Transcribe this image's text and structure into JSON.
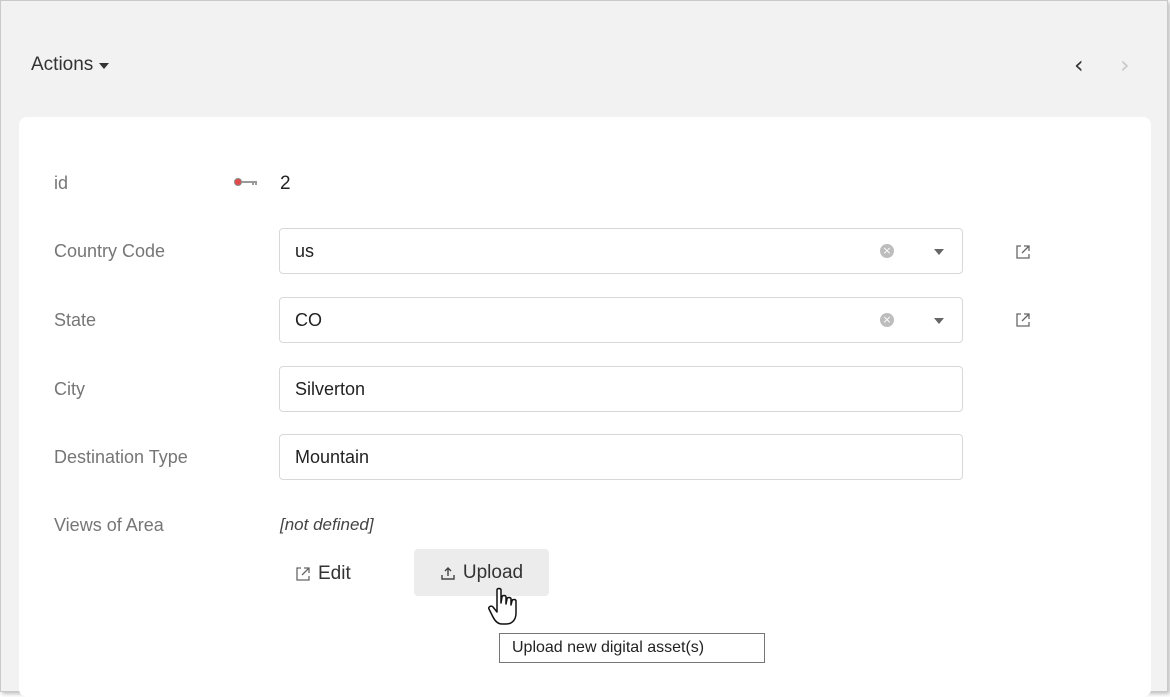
{
  "toolbar": {
    "actions_label": "Actions",
    "caret_icon": "caret-down-icon",
    "prev_icon": "chevron-left-icon",
    "prev_glyph": "‹",
    "next_icon": "chevron-right-icon",
    "next_glyph": "›"
  },
  "form": {
    "id": {
      "label": "id",
      "value": "2",
      "icon": "key-icon"
    },
    "country_code": {
      "label": "Country Code",
      "value": "us"
    },
    "state": {
      "label": "State",
      "value": "CO"
    },
    "city": {
      "label": "City",
      "value": "Silverton"
    },
    "destination_type": {
      "label": "Destination Type",
      "value": "Mountain"
    },
    "views_of_area": {
      "label": "Views of Area",
      "value": "[not defined]",
      "edit_label": "Edit",
      "upload_label": "Upload"
    }
  },
  "tooltip": {
    "text": "Upload new digital asset(s)"
  },
  "colors": {
    "background": "#f2f2f2",
    "panel": "#ffffff",
    "label": "#767676",
    "upload_button_bg": "#ececec"
  }
}
